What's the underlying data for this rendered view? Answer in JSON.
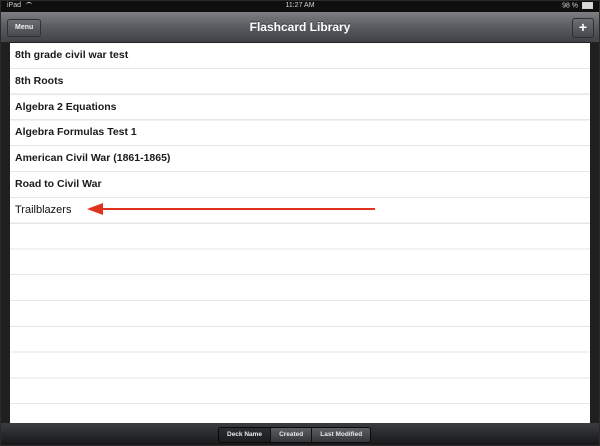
{
  "status": {
    "device": "iPad",
    "time": "11:27 AM",
    "battery": "98 %"
  },
  "nav": {
    "menu_label": "Menu",
    "title": "Flashcard Library",
    "add_label": "+"
  },
  "decks": [
    {
      "name": "8th grade civil war test"
    },
    {
      "name": "8th Roots"
    },
    {
      "name": "Algebra 2 Equations"
    },
    {
      "name": "Algebra Formulas Test 1"
    },
    {
      "name": "American Civil War (1861-1865)"
    },
    {
      "name": "Road to Civil War"
    },
    {
      "name": "Trailblazers"
    }
  ],
  "annotation": {
    "arrow_color": "#e0321e"
  },
  "sort_tabs": [
    {
      "label": "Deck Name",
      "active": true
    },
    {
      "label": "Created",
      "active": false
    },
    {
      "label": "Last Modified",
      "active": false
    }
  ]
}
